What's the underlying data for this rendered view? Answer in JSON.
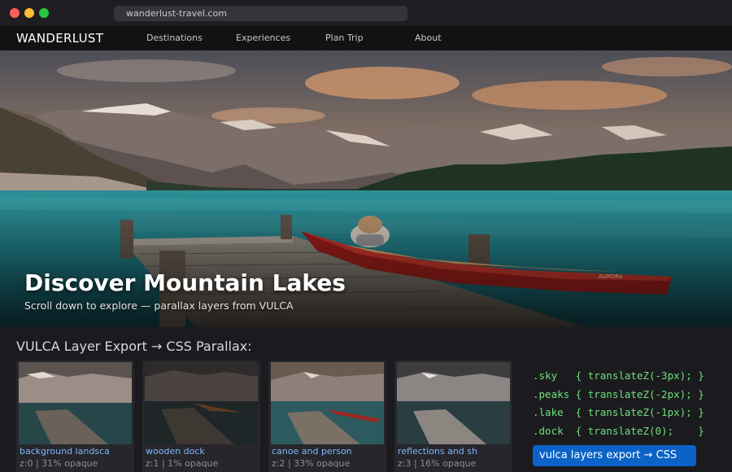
{
  "browser": {
    "url": "wanderlust-travel.com"
  },
  "nav": {
    "brand": "WANDERLUST",
    "links": [
      {
        "label": "Destinations"
      },
      {
        "label": "Experiences"
      },
      {
        "label": "Plan Trip"
      },
      {
        "label": "About"
      }
    ]
  },
  "hero": {
    "title": "Discover Mountain Lakes",
    "subtitle": "Scroll down to explore — parallax layers from VULCA",
    "canoe_text": "AURORA"
  },
  "layers": {
    "title": "VULCA Layer Export → CSS Parallax:",
    "cards": [
      {
        "name": "background landsca",
        "meta": "z:0 | 31% opaque"
      },
      {
        "name": "wooden dock",
        "meta": "z:1 | 1% opaque"
      },
      {
        "name": "canoe and person",
        "meta": "z:2 | 33% opaque"
      },
      {
        "name": "reflections and sh",
        "meta": "z:3 | 16% opaque"
      }
    ],
    "code": [
      ".sky   { translateZ(-3px); }",
      ".peaks { translateZ(-2px); }",
      ".lake  { translateZ(-1px); }",
      ".dock  { translateZ(0);    }"
    ],
    "button": "vulca layers export → CSS"
  },
  "icons": {
    "window_close": "red-dot",
    "window_minimize": "yellow-dot",
    "window_maximize": "green-dot"
  }
}
